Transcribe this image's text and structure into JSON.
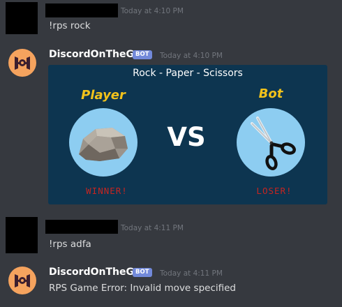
{
  "messages": [
    {
      "time": "Today at 4:10 PM",
      "text": "!rps rock"
    },
    {
      "username": "DiscordOnTheGo",
      "tag": "BOT",
      "time": "Today at 4:10 PM"
    },
    {
      "time": "Today at 4:11 PM",
      "text": "!rps adfa"
    },
    {
      "username": "DiscordOnTheGo",
      "tag": "BOT",
      "time": "Today at 4:11 PM",
      "text": "RPS Game Error: Invalid move specified"
    }
  ],
  "embed": {
    "title": "Rock - Paper - Scissors",
    "player_label": "Player",
    "bot_label": "Bot",
    "vs": "VS",
    "player_result": "WINNER!",
    "bot_result": "LOSER!",
    "player_move_icon": "rock-icon",
    "bot_move_icon": "scissors-icon"
  },
  "colors": {
    "background": "#36393f",
    "embed_background": "#0d3550",
    "label_yellow": "#f2c21b",
    "result_red": "#c62521",
    "bot_tag": "#7289da"
  }
}
